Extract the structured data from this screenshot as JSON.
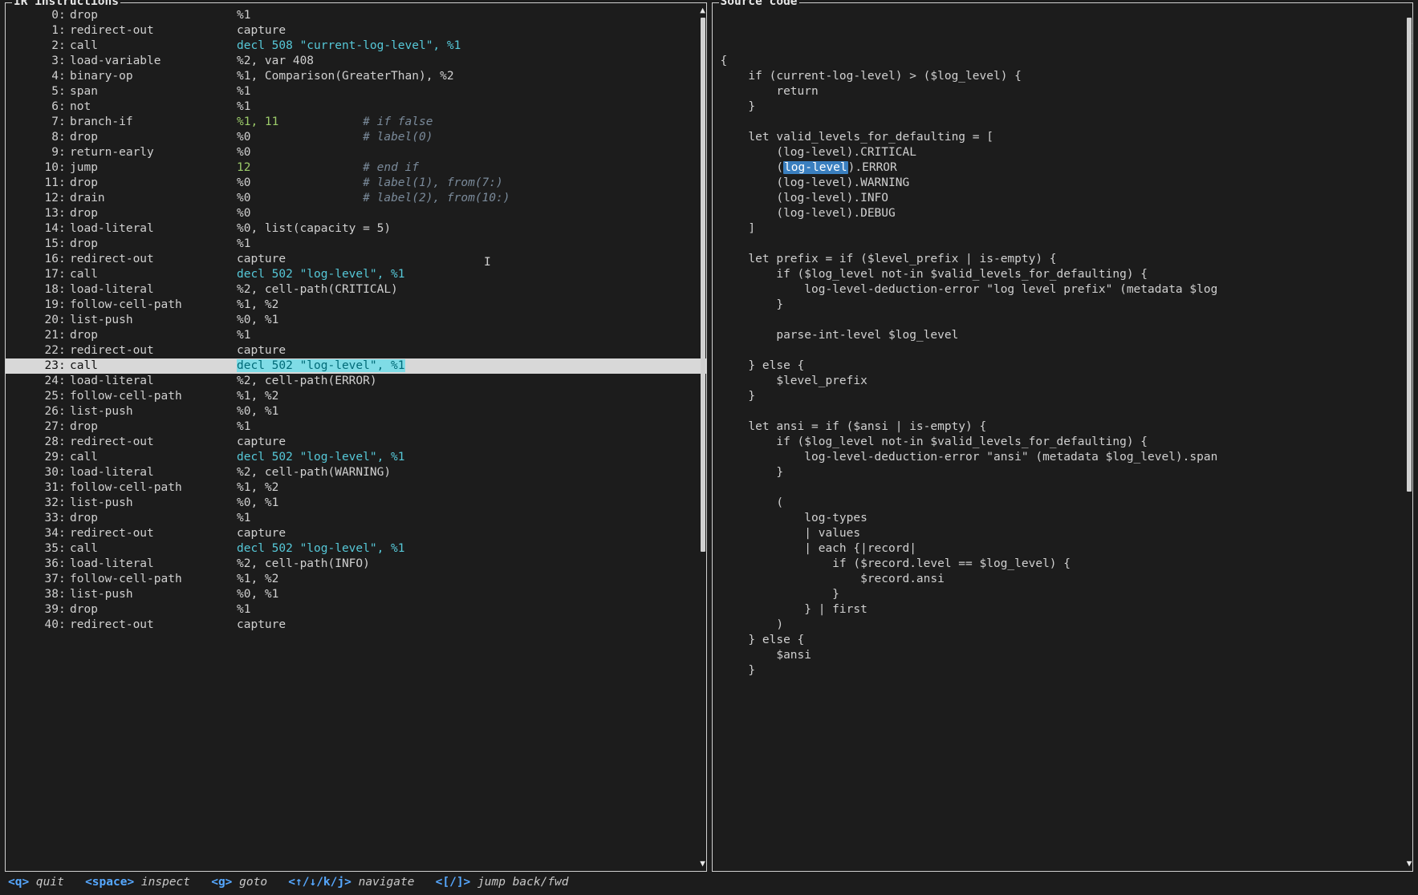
{
  "panels": {
    "ir_title": "IR instructions",
    "src_title": "Source code"
  },
  "highlight_index": 23,
  "ir": [
    {
      "n": "0",
      "mnem": "drop",
      "args_plain": "%1"
    },
    {
      "n": "1",
      "mnem": "redirect-out",
      "args_plain": "capture"
    },
    {
      "n": "2",
      "mnem": "call",
      "args_cyan": "decl 508 \"current-log-level\", %1"
    },
    {
      "n": "3",
      "mnem": "load-variable",
      "args_plain": "%2, var 408"
    },
    {
      "n": "4",
      "mnem": "binary-op",
      "args_plain": "%1, Comparison(GreaterThan), %2"
    },
    {
      "n": "5",
      "mnem": "span",
      "args_plain": "%1"
    },
    {
      "n": "6",
      "mnem": "not",
      "args_plain": "%1"
    },
    {
      "n": "7",
      "mnem": "branch-if",
      "args_green": "%1, 11",
      "comment": "# if false"
    },
    {
      "n": "8",
      "mnem": "drop",
      "args_plain": "%0",
      "comment": "# label(0)"
    },
    {
      "n": "9",
      "mnem": "return-early",
      "args_plain": "%0"
    },
    {
      "n": "10",
      "mnem": "jump",
      "args_green": "12",
      "comment": "# end if"
    },
    {
      "n": "11",
      "mnem": "drop",
      "args_plain": "%0",
      "comment": "# label(1), from(7:)"
    },
    {
      "n": "12",
      "mnem": "drain",
      "args_plain": "%0",
      "comment": "# label(2), from(10:)"
    },
    {
      "n": "13",
      "mnem": "drop",
      "args_plain": "%0"
    },
    {
      "n": "14",
      "mnem": "load-literal",
      "args_plain": "%0, list(capacity = 5)"
    },
    {
      "n": "15",
      "mnem": "drop",
      "args_plain": "%1"
    },
    {
      "n": "16",
      "mnem": "redirect-out",
      "args_plain": "capture"
    },
    {
      "n": "17",
      "mnem": "call",
      "args_cyan": "decl 502 \"log-level\", %1"
    },
    {
      "n": "18",
      "mnem": "load-literal",
      "args_plain": "%2, cell-path(CRITICAL)"
    },
    {
      "n": "19",
      "mnem": "follow-cell-path",
      "args_plain": "%1, %2"
    },
    {
      "n": "20",
      "mnem": "list-push",
      "args_plain": "%0, %1"
    },
    {
      "n": "21",
      "mnem": "drop",
      "args_plain": "%1"
    },
    {
      "n": "22",
      "mnem": "redirect-out",
      "args_plain": "capture"
    },
    {
      "n": "23",
      "mnem": "call",
      "args_cyan": "decl 502 \"log-level\", %1"
    },
    {
      "n": "24",
      "mnem": "load-literal",
      "args_plain": "%2, cell-path(ERROR)"
    },
    {
      "n": "25",
      "mnem": "follow-cell-path",
      "args_plain": "%1, %2"
    },
    {
      "n": "26",
      "mnem": "list-push",
      "args_plain": "%0, %1"
    },
    {
      "n": "27",
      "mnem": "drop",
      "args_plain": "%1"
    },
    {
      "n": "28",
      "mnem": "redirect-out",
      "args_plain": "capture"
    },
    {
      "n": "29",
      "mnem": "call",
      "args_cyan": "decl 502 \"log-level\", %1"
    },
    {
      "n": "30",
      "mnem": "load-literal",
      "args_plain": "%2, cell-path(WARNING)"
    },
    {
      "n": "31",
      "mnem": "follow-cell-path",
      "args_plain": "%1, %2"
    },
    {
      "n": "32",
      "mnem": "list-push",
      "args_plain": "%0, %1"
    },
    {
      "n": "33",
      "mnem": "drop",
      "args_plain": "%1"
    },
    {
      "n": "34",
      "mnem": "redirect-out",
      "args_plain": "capture"
    },
    {
      "n": "35",
      "mnem": "call",
      "args_cyan": "decl 502 \"log-level\", %1"
    },
    {
      "n": "36",
      "mnem": "load-literal",
      "args_plain": "%2, cell-path(INFO)"
    },
    {
      "n": "37",
      "mnem": "follow-cell-path",
      "args_plain": "%1, %2"
    },
    {
      "n": "38",
      "mnem": "list-push",
      "args_plain": "%0, %1"
    },
    {
      "n": "39",
      "mnem": "drop",
      "args_plain": "%1"
    },
    {
      "n": "40",
      "mnem": "redirect-out",
      "args_plain": "capture"
    }
  ],
  "src": [
    {
      "t": "{"
    },
    {
      "t": "    if (current-log-level) > ($log_level) {"
    },
    {
      "t": "        return"
    },
    {
      "t": "    }"
    },
    {
      "t": ""
    },
    {
      "t": "    let valid_levels_for_defaulting = ["
    },
    {
      "t": "        (log-level).CRITICAL"
    },
    {
      "pre": "        (",
      "hl": "log-level",
      "post": ").ERROR"
    },
    {
      "t": "        (log-level).WARNING"
    },
    {
      "t": "        (log-level).INFO"
    },
    {
      "t": "        (log-level).DEBUG"
    },
    {
      "t": "    ]"
    },
    {
      "t": ""
    },
    {
      "t": "    let prefix = if ($level_prefix | is-empty) {"
    },
    {
      "t": "        if ($log_level not-in $valid_levels_for_defaulting) {"
    },
    {
      "t": "            log-level-deduction-error \"log level prefix\" (metadata $log"
    },
    {
      "t": "        }"
    },
    {
      "t": ""
    },
    {
      "t": "        parse-int-level $log_level"
    },
    {
      "t": ""
    },
    {
      "t": "    } else {"
    },
    {
      "t": "        $level_prefix"
    },
    {
      "t": "    }"
    },
    {
      "t": ""
    },
    {
      "t": "    let ansi = if ($ansi | is-empty) {"
    },
    {
      "t": "        if ($log_level not-in $valid_levels_for_defaulting) {"
    },
    {
      "t": "            log-level-deduction-error \"ansi\" (metadata $log_level).span"
    },
    {
      "t": "        }"
    },
    {
      "t": ""
    },
    {
      "t": "        ("
    },
    {
      "t": "            log-types"
    },
    {
      "t": "            | values"
    },
    {
      "t": "            | each {|record|"
    },
    {
      "t": "                if ($record.level == $log_level) {"
    },
    {
      "t": "                    $record.ansi"
    },
    {
      "t": "                }"
    },
    {
      "t": "            } | first"
    },
    {
      "t": "        )"
    },
    {
      "t": "    } else {"
    },
    {
      "t": "        $ansi"
    },
    {
      "t": "    }"
    }
  ],
  "footer": [
    {
      "key": "<q>",
      "desc": "quit"
    },
    {
      "key": "<space>",
      "desc": "inspect"
    },
    {
      "key": "<g>",
      "desc": "goto"
    },
    {
      "key": "<↑/↓/k/j>",
      "desc": "navigate"
    },
    {
      "key": "<[/]>",
      "desc": "jump back/fwd"
    }
  ]
}
